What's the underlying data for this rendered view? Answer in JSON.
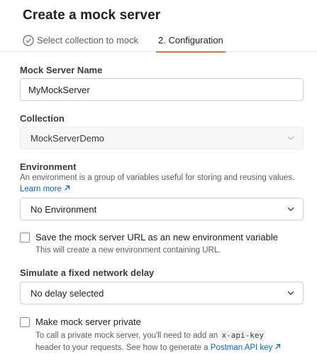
{
  "header": {
    "title": "Create a mock server"
  },
  "tabs": [
    {
      "label": "Select collection to mock",
      "completed": true
    },
    {
      "label": "2. Configuration",
      "active": true
    }
  ],
  "mock_name": {
    "label": "Mock Server Name",
    "value": "MyMockServer"
  },
  "collection": {
    "label": "Collection",
    "value": "MockServerDemo"
  },
  "environment": {
    "label": "Environment",
    "description": "An environment is a group of variables useful for storing and reusing values.",
    "learn_more": "Learn more",
    "value": "No Environment"
  },
  "save_env_var": {
    "label": "Save the mock server URL as an new environment variable",
    "help": "This will create a new environment containing URL."
  },
  "delay": {
    "label": "Simulate a fixed network delay",
    "value": "No delay selected"
  },
  "private": {
    "label": "Make mock server private",
    "help_part1": "To call a private mock server, you'll need to add an",
    "help_code": "x-api-key",
    "help_part2": "header to your requests. See how to generate a",
    "help_link": "Postman API key"
  },
  "colors": {
    "accent": "#f26b3a",
    "link": "#0265d2",
    "text": "#212121"
  }
}
